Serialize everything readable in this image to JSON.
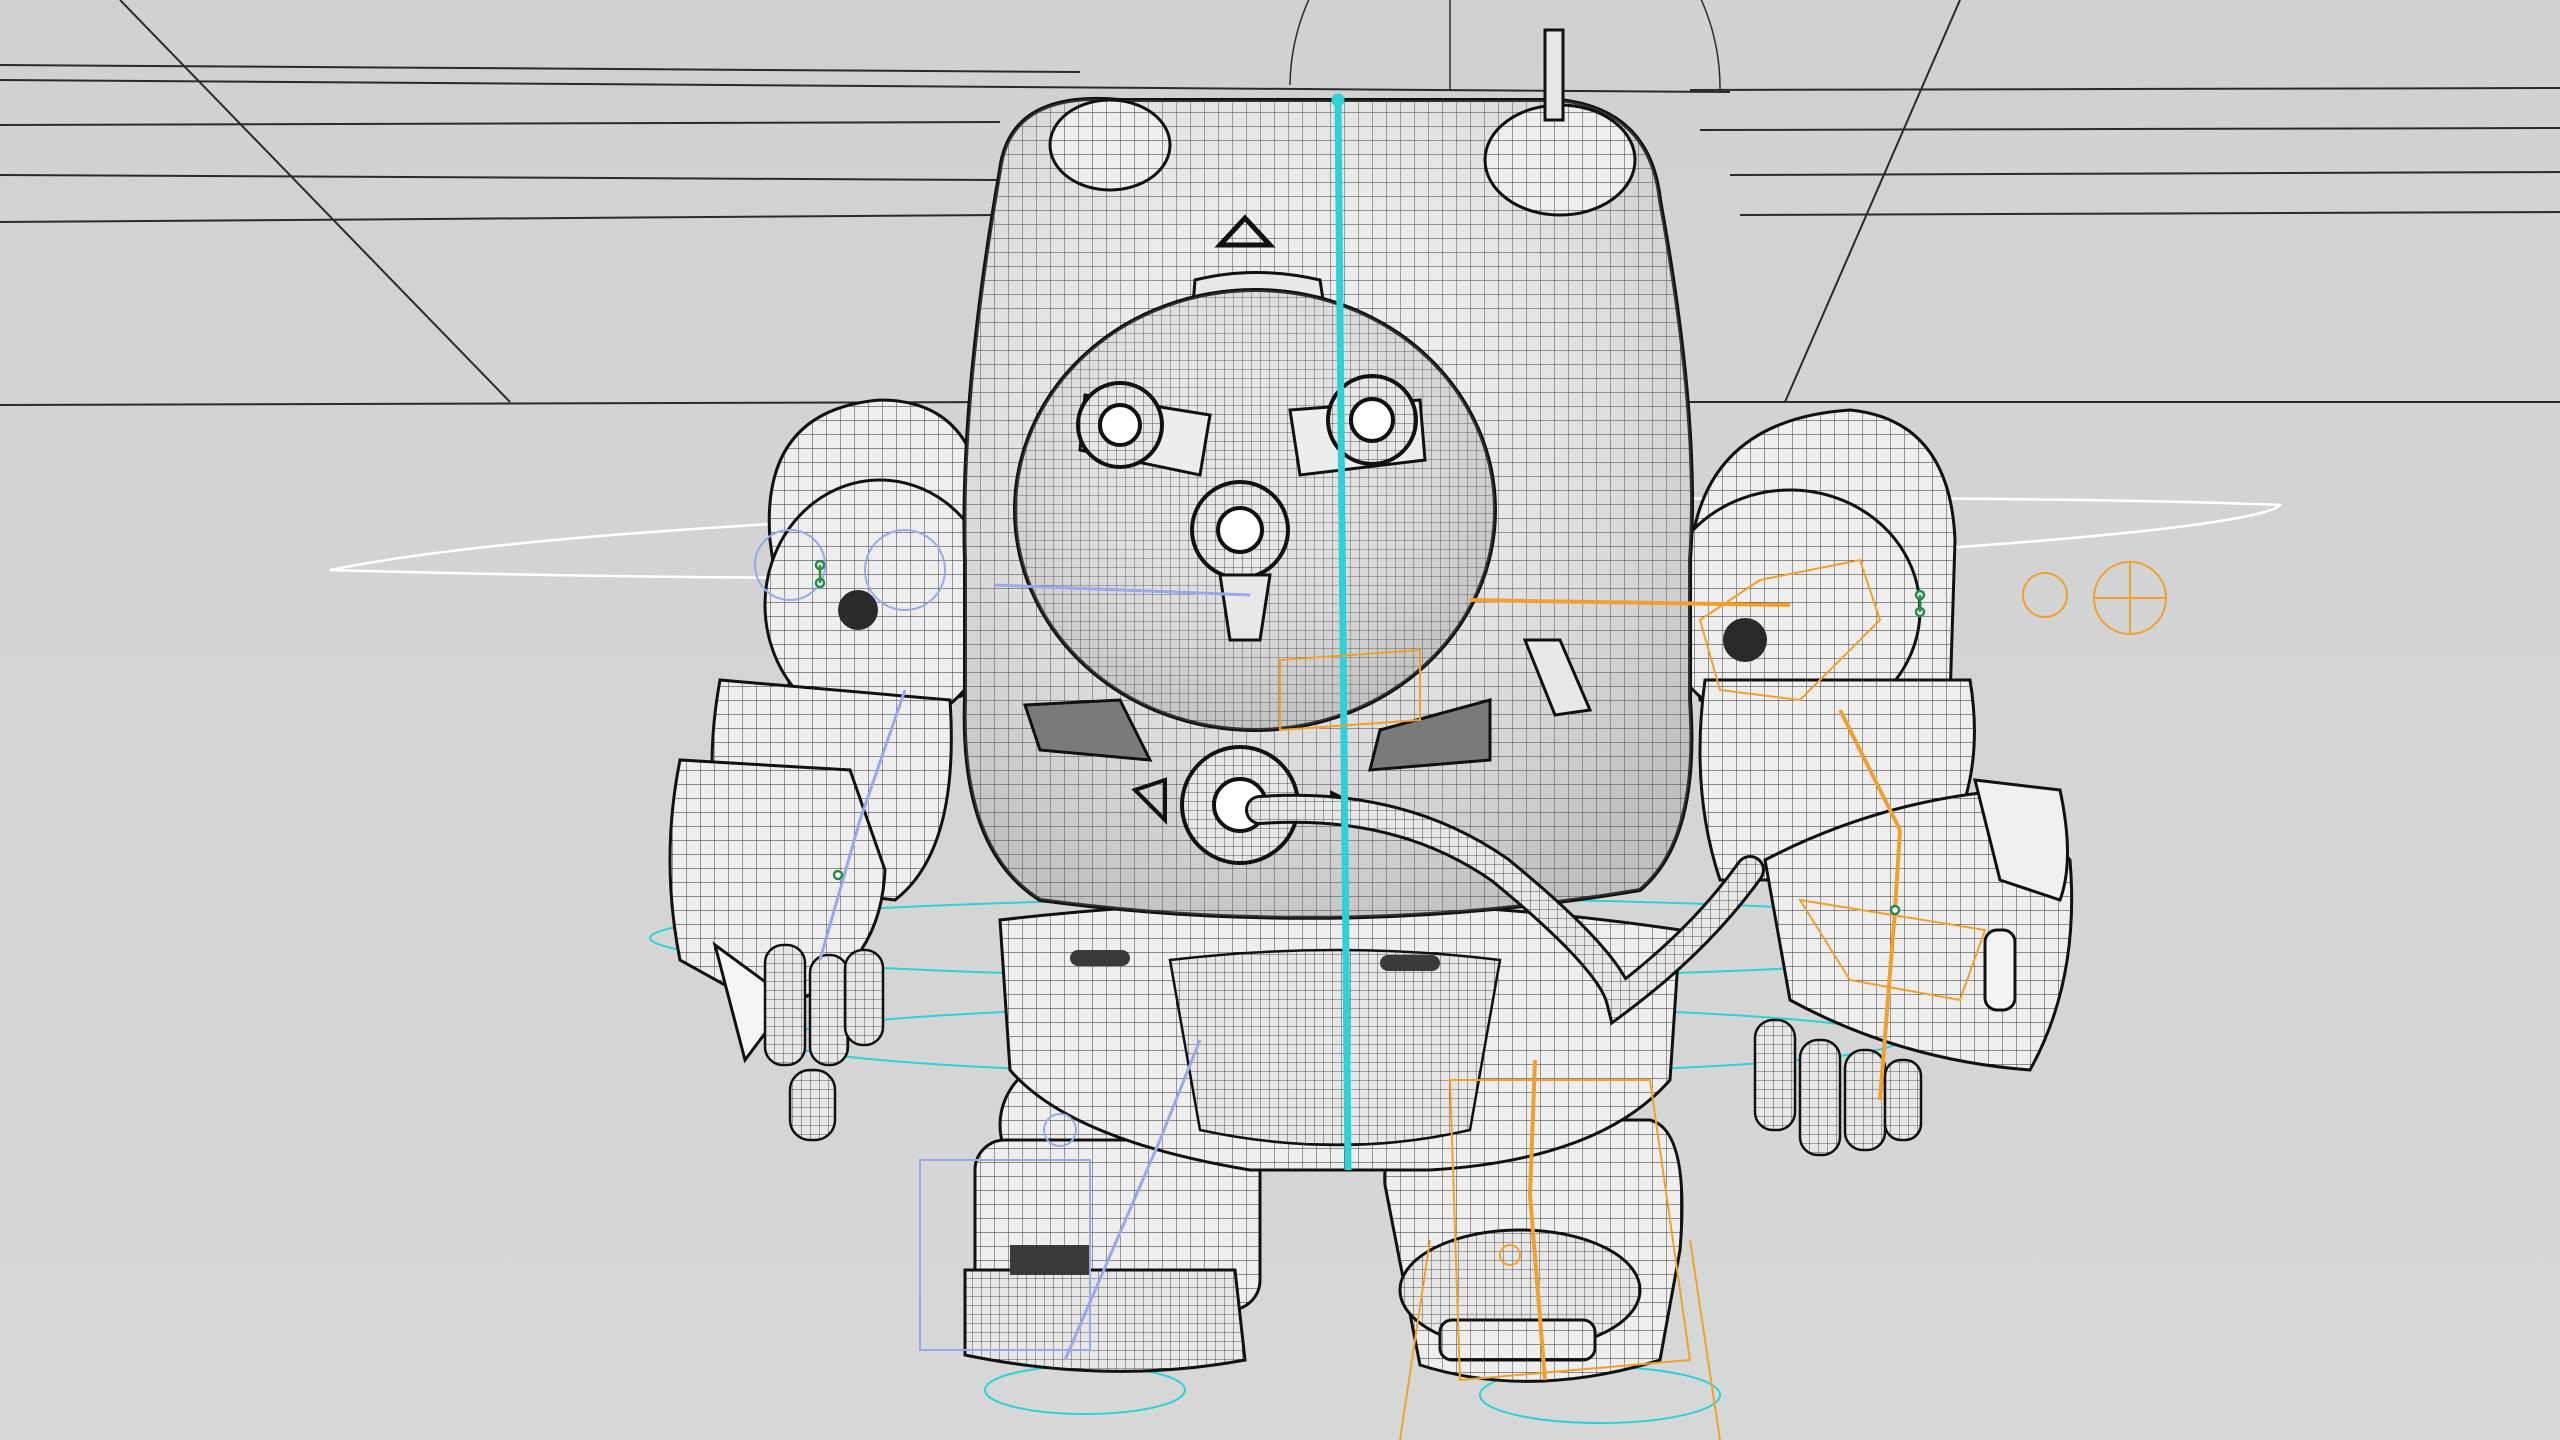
{
  "viewport": {
    "background_color": "#d3d5d5",
    "wire_color": "#222222",
    "shading_color": "#ececec",
    "spine_control_color": "#2fd0d6",
    "left_ik_color": "#f0a030",
    "right_ik_color": "#9aa8e8",
    "joint_color": "#2a8a4a"
  },
  "scene": {
    "subject": "robot-mech-wireframe",
    "display_mode": "wireframe-on-shaded",
    "rig_controls_visible": true
  }
}
